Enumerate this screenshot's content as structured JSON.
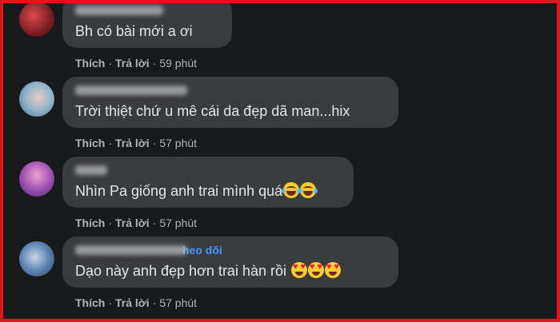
{
  "comments": [
    {
      "text": "Bh có bài mới a ơi",
      "emojis": [],
      "follow": "",
      "actions": {
        "like": "Thích",
        "reply": "Trả lời",
        "time": "59 phút"
      }
    },
    {
      "text": "Trời thiệt chứ u mê cái da đẹp dã man...hix",
      "emojis": [],
      "follow": "",
      "actions": {
        "like": "Thích",
        "reply": "Trả lời",
        "time": "57 phút"
      }
    },
    {
      "text": "Nhìn Pa giống anh trai mình quá",
      "emojis": [
        "laughing-with-tears",
        "laughing-with-tears"
      ],
      "follow": "",
      "actions": {
        "like": "Thích",
        "reply": "Trả lời",
        "time": "57 phút"
      }
    },
    {
      "text": "Dạo này anh đẹp hơn trai hàn rồi ",
      "emojis": [
        "heart-eyes",
        "heart-eyes",
        "heart-eyes"
      ],
      "follow": "heo dõi",
      "actions": {
        "like": "Thích",
        "reply": "Trả lời",
        "time": "57 phút"
      }
    }
  ],
  "separator": "·",
  "colors": {
    "background": "#18191a",
    "bubble": "#3a3b3c",
    "text": "#e4e6eb",
    "meta": "#b0b3b8",
    "follow": "#4599ff",
    "frame": "#e0151b"
  }
}
